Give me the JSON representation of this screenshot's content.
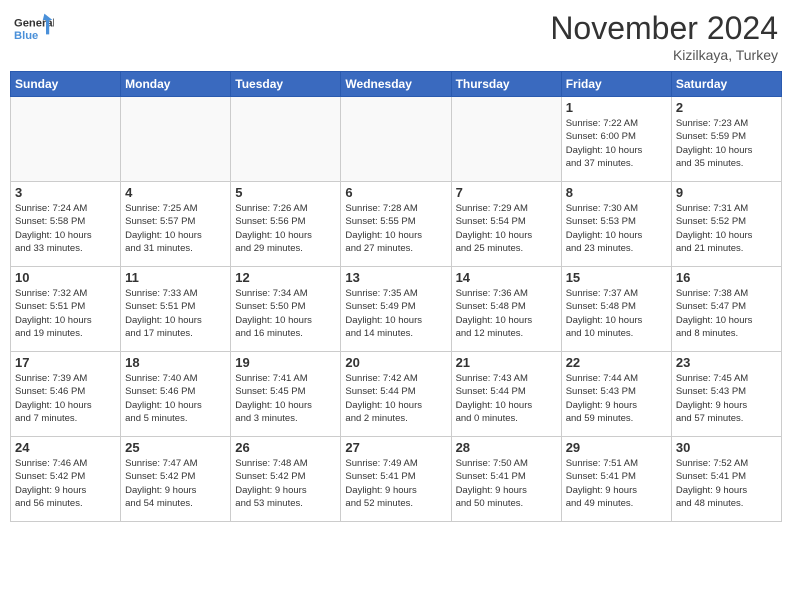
{
  "logo": {
    "line1": "General",
    "line2": "Blue"
  },
  "title": "November 2024",
  "location": "Kizilkaya, Turkey",
  "weekdays": [
    "Sunday",
    "Monday",
    "Tuesday",
    "Wednesday",
    "Thursday",
    "Friday",
    "Saturday"
  ],
  "weeks": [
    [
      {
        "day": "",
        "info": ""
      },
      {
        "day": "",
        "info": ""
      },
      {
        "day": "",
        "info": ""
      },
      {
        "day": "",
        "info": ""
      },
      {
        "day": "",
        "info": ""
      },
      {
        "day": "1",
        "info": "Sunrise: 7:22 AM\nSunset: 6:00 PM\nDaylight: 10 hours\nand 37 minutes."
      },
      {
        "day": "2",
        "info": "Sunrise: 7:23 AM\nSunset: 5:59 PM\nDaylight: 10 hours\nand 35 minutes."
      }
    ],
    [
      {
        "day": "3",
        "info": "Sunrise: 7:24 AM\nSunset: 5:58 PM\nDaylight: 10 hours\nand 33 minutes."
      },
      {
        "day": "4",
        "info": "Sunrise: 7:25 AM\nSunset: 5:57 PM\nDaylight: 10 hours\nand 31 minutes."
      },
      {
        "day": "5",
        "info": "Sunrise: 7:26 AM\nSunset: 5:56 PM\nDaylight: 10 hours\nand 29 minutes."
      },
      {
        "day": "6",
        "info": "Sunrise: 7:28 AM\nSunset: 5:55 PM\nDaylight: 10 hours\nand 27 minutes."
      },
      {
        "day": "7",
        "info": "Sunrise: 7:29 AM\nSunset: 5:54 PM\nDaylight: 10 hours\nand 25 minutes."
      },
      {
        "day": "8",
        "info": "Sunrise: 7:30 AM\nSunset: 5:53 PM\nDaylight: 10 hours\nand 23 minutes."
      },
      {
        "day": "9",
        "info": "Sunrise: 7:31 AM\nSunset: 5:52 PM\nDaylight: 10 hours\nand 21 minutes."
      }
    ],
    [
      {
        "day": "10",
        "info": "Sunrise: 7:32 AM\nSunset: 5:51 PM\nDaylight: 10 hours\nand 19 minutes."
      },
      {
        "day": "11",
        "info": "Sunrise: 7:33 AM\nSunset: 5:51 PM\nDaylight: 10 hours\nand 17 minutes."
      },
      {
        "day": "12",
        "info": "Sunrise: 7:34 AM\nSunset: 5:50 PM\nDaylight: 10 hours\nand 16 minutes."
      },
      {
        "day": "13",
        "info": "Sunrise: 7:35 AM\nSunset: 5:49 PM\nDaylight: 10 hours\nand 14 minutes."
      },
      {
        "day": "14",
        "info": "Sunrise: 7:36 AM\nSunset: 5:48 PM\nDaylight: 10 hours\nand 12 minutes."
      },
      {
        "day": "15",
        "info": "Sunrise: 7:37 AM\nSunset: 5:48 PM\nDaylight: 10 hours\nand 10 minutes."
      },
      {
        "day": "16",
        "info": "Sunrise: 7:38 AM\nSunset: 5:47 PM\nDaylight: 10 hours\nand 8 minutes."
      }
    ],
    [
      {
        "day": "17",
        "info": "Sunrise: 7:39 AM\nSunset: 5:46 PM\nDaylight: 10 hours\nand 7 minutes."
      },
      {
        "day": "18",
        "info": "Sunrise: 7:40 AM\nSunset: 5:46 PM\nDaylight: 10 hours\nand 5 minutes."
      },
      {
        "day": "19",
        "info": "Sunrise: 7:41 AM\nSunset: 5:45 PM\nDaylight: 10 hours\nand 3 minutes."
      },
      {
        "day": "20",
        "info": "Sunrise: 7:42 AM\nSunset: 5:44 PM\nDaylight: 10 hours\nand 2 minutes."
      },
      {
        "day": "21",
        "info": "Sunrise: 7:43 AM\nSunset: 5:44 PM\nDaylight: 10 hours\nand 0 minutes."
      },
      {
        "day": "22",
        "info": "Sunrise: 7:44 AM\nSunset: 5:43 PM\nDaylight: 9 hours\nand 59 minutes."
      },
      {
        "day": "23",
        "info": "Sunrise: 7:45 AM\nSunset: 5:43 PM\nDaylight: 9 hours\nand 57 minutes."
      }
    ],
    [
      {
        "day": "24",
        "info": "Sunrise: 7:46 AM\nSunset: 5:42 PM\nDaylight: 9 hours\nand 56 minutes."
      },
      {
        "day": "25",
        "info": "Sunrise: 7:47 AM\nSunset: 5:42 PM\nDaylight: 9 hours\nand 54 minutes."
      },
      {
        "day": "26",
        "info": "Sunrise: 7:48 AM\nSunset: 5:42 PM\nDaylight: 9 hours\nand 53 minutes."
      },
      {
        "day": "27",
        "info": "Sunrise: 7:49 AM\nSunset: 5:41 PM\nDaylight: 9 hours\nand 52 minutes."
      },
      {
        "day": "28",
        "info": "Sunrise: 7:50 AM\nSunset: 5:41 PM\nDaylight: 9 hours\nand 50 minutes."
      },
      {
        "day": "29",
        "info": "Sunrise: 7:51 AM\nSunset: 5:41 PM\nDaylight: 9 hours\nand 49 minutes."
      },
      {
        "day": "30",
        "info": "Sunrise: 7:52 AM\nSunset: 5:41 PM\nDaylight: 9 hours\nand 48 minutes."
      }
    ]
  ]
}
